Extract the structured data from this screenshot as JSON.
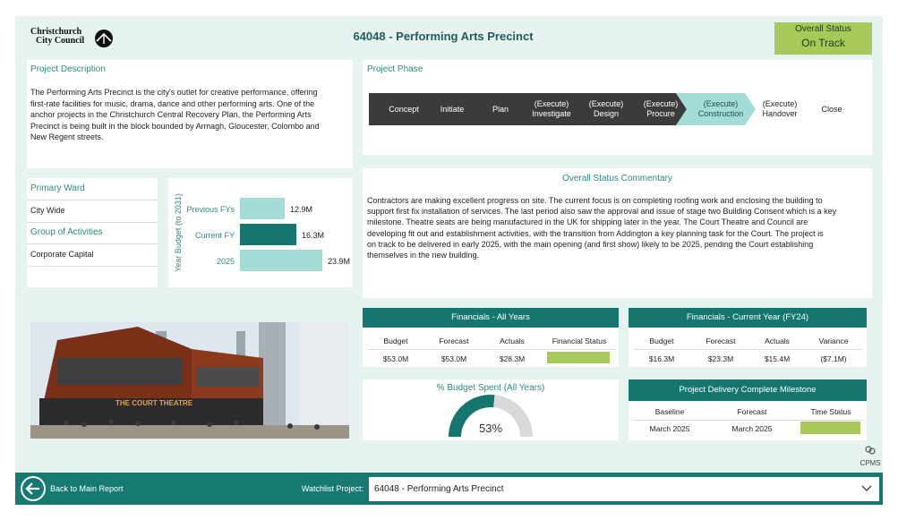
{
  "header": {
    "logo_line1": "Christchurch",
    "logo_line2": "City Council",
    "title": "64048 - Performing Arts Precinct",
    "status_label": "Overall Status",
    "status_value": "On Track"
  },
  "project_description": {
    "title": "Project Description",
    "lines": [
      "The Performing Arts Precinct is the city's outlet for creative performance, offering",
      "first-rate facilities for music, drama, dance and other performing arts. One of the",
      "anchor projects in the Christchurch Central Recovery Plan, the Performing Arts",
      "Precinct is being built in the block bounded by Armagh, Gloucester, Colombo and",
      "New Regent streets."
    ]
  },
  "project_phase": {
    "title": "Project Phase",
    "phases": [
      {
        "l1": "Concept",
        "l2": ""
      },
      {
        "l1": "Initiate",
        "l2": ""
      },
      {
        "l1": "Plan",
        "l2": ""
      },
      {
        "l1": "(Execute)",
        "l2": "Investigate"
      },
      {
        "l1": "(Execute)",
        "l2": "Design"
      },
      {
        "l1": "(Execute)",
        "l2": "Procure"
      },
      {
        "l1": "(Execute)",
        "l2": "Construction"
      },
      {
        "l1": "(Execute)",
        "l2": "Handover"
      },
      {
        "l1": "Close",
        "l2": ""
      }
    ],
    "active_index": 6
  },
  "ward": {
    "primary_ward_label": "Primary Ward",
    "primary_ward_value": "City Wide",
    "group_label": "Group of Activities",
    "group_value": "Corporate Capital"
  },
  "budget_chart": {
    "ylabel": "Year Budget (to 2031)",
    "bars": [
      {
        "label": "Previous FYs",
        "value": 12.9,
        "display": "12.9M",
        "color": "#a4dcd8"
      },
      {
        "label": "Current FY",
        "value": 16.3,
        "display": "16.3M",
        "color": "#14766f"
      },
      {
        "label": "2025",
        "value": 23.9,
        "display": "23.9M",
        "color": "#a4dcd8"
      }
    ],
    "max": 23.9
  },
  "commentary": {
    "title": "Overall Status Commentary",
    "lines": [
      "Contractors are making excellent progress on site. The current focus is on completing roofing work and enclosing the building to",
      "support first fix installation of services. The last period also saw the approval and issue of stage two Building Consent which is a key",
      "milestone. Theatre seats are being manufactured in the UK for shipping later in the year. The Court Theatre and Council are",
      "developing fit out and establishment activities, with the transition from Addington a key planning task for the Court. The project is",
      "on track to be delivered in early 2025, with the main opening (and first show) likely to be 2025, pending the Court establishing",
      "themselves in the new building."
    ]
  },
  "image": {
    "sign_text": "THE COURT THEATRE"
  },
  "fin_all": {
    "title": "Financials - All Years",
    "headers": [
      "Budget",
      "Forecast",
      "Actuals",
      "Financial Status"
    ],
    "values": [
      "$53.0M",
      "$53.0M",
      "$28.3M"
    ],
    "status_color": "#a6c95a"
  },
  "fin_current": {
    "title": "Financials - Current Year (FY24)",
    "headers": [
      "Budget",
      "Forecast",
      "Actuals",
      "Variance"
    ],
    "values": [
      "$16.3M",
      "$23.3M",
      "$15.4M",
      "($7.1M)"
    ]
  },
  "budget_spent": {
    "title": "% Budget Spent (All Years)",
    "percent": 53,
    "display": "53%",
    "fill_color": "#14766f",
    "rest_color": "#d9d9d9"
  },
  "milestone": {
    "title": "Project Delivery Complete Milestone",
    "headers": [
      "Baseline",
      "Forecast",
      "Time Status"
    ],
    "values": [
      "March 2025",
      "March 2025"
    ],
    "status_color": "#a6c95a"
  },
  "cpms_label": "CPMS",
  "footer": {
    "back_label": "Back to Main Report",
    "watchlist_label": "Watchlist Project:",
    "watchlist_value": "64048 - Performing Arts Precinct"
  }
}
